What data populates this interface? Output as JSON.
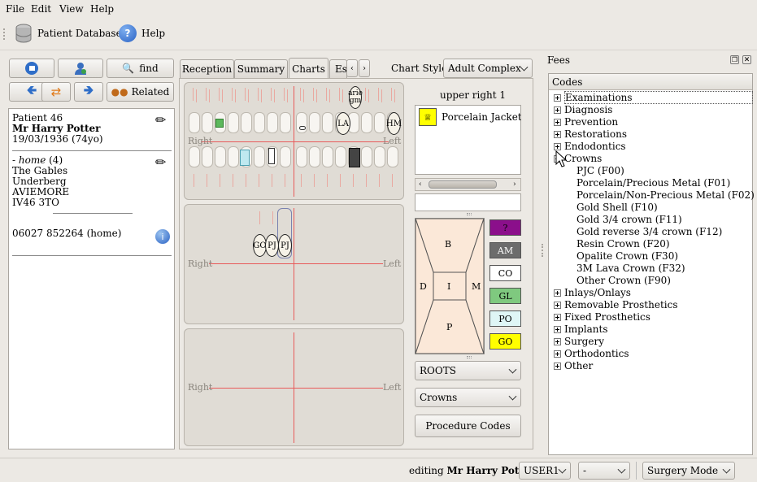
{
  "menu": {
    "file": "File",
    "edit": "Edit",
    "view": "View",
    "help": "Help"
  },
  "toolbar": {
    "patient_db": "Patient Database",
    "help": "Help"
  },
  "nav": {
    "find": "find",
    "related": "Related"
  },
  "patient": {
    "number": "Patient 46",
    "name": "Mr Harry Potter",
    "dob": "19/03/1936 (74yo)",
    "address_label": "- home",
    "address_count": " (4)",
    "address_lines": [
      "The Gables",
      "Underberg",
      "AVIEMORE",
      "IV46 3TO"
    ],
    "phone": "06027 852264 (home)"
  },
  "tabs": [
    "Reception",
    "Summary",
    "Charts",
    "Es"
  ],
  "chart_style": {
    "label": "Chart Style",
    "value": "Adult Complex"
  },
  "chart": {
    "right": "Right",
    "left": "Left",
    "mark_ariegm": "arie gm",
    "mark_la": "LA",
    "mark_hm": "HM",
    "mark_go": "GO",
    "mark_pj1": "PJ",
    "mark_pj2": "PJ"
  },
  "tooth_panel": {
    "title": "upper right 1",
    "item": "Porcelain Jacket Cr",
    "surfaces": {
      "b": "B",
      "d": "D",
      "i": "I",
      "m": "M",
      "p": "P"
    }
  },
  "swatches": [
    {
      "label": "?",
      "color": "#8b0f8b"
    },
    {
      "label": "AM",
      "color": "#6c6c6c"
    },
    {
      "label": "CO",
      "color": "#ffffff"
    },
    {
      "label": "GL",
      "color": "#7fc97f"
    },
    {
      "label": "PO",
      "color": "#dff6f6"
    },
    {
      "label": "GO",
      "color": "#ffff00"
    }
  ],
  "combos": {
    "roots": "ROOTS",
    "crowns": "Crowns",
    "procedure_codes": "Procedure Codes"
  },
  "fees": {
    "title": "Fees",
    "codes_header": "Codes",
    "top_items": [
      "Examinations",
      "Diagnosis",
      "Prevention",
      "Restorations",
      "Endodontics",
      "Crowns"
    ],
    "crown_items": [
      "PJC (F00)",
      "Porcelain/Precious Metal (F01)",
      "Porcelain/Non-Precious Metal (F02)",
      "Gold Shell (F10)",
      "Gold 3/4 crown (F11)",
      "Gold reverse 3/4 crown (F12)",
      "Resin Crown (F20)",
      "Opalite Crown (F30)",
      "3M Lava Crown (F32)",
      "Other Crown (F90)"
    ],
    "bottom_items": [
      "Inlays/Onlays",
      "Removable Prosthetics",
      "Fixed Prosthetics",
      "Implants",
      "Surgery",
      "Orthodontics",
      "Other"
    ]
  },
  "status": {
    "editing": "editing ",
    "name": "Mr Harry Potter",
    "user": "USER1",
    "dash": "-",
    "mode": "Surgery Mode"
  }
}
